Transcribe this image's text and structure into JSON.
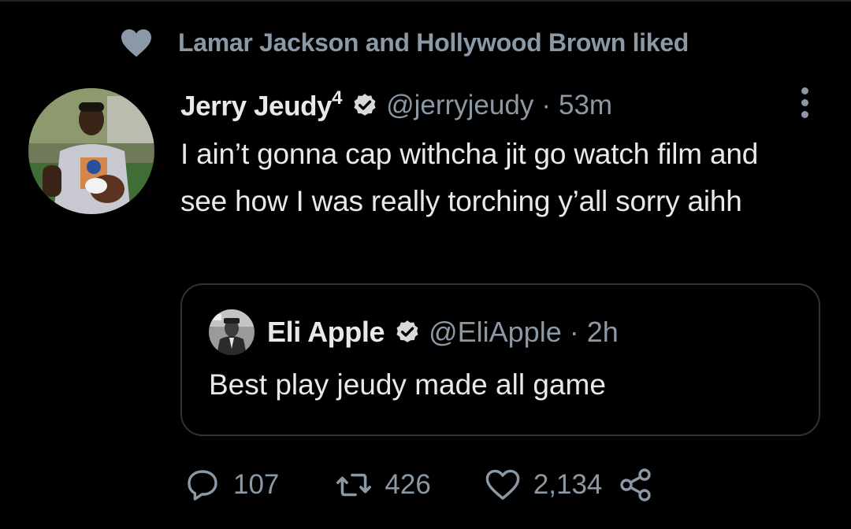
{
  "social_context": {
    "icon": "heart-icon",
    "text": "Lamar Jackson and Hollywood Brown liked"
  },
  "tweet": {
    "author": {
      "display_name": "Jerry Jeudy",
      "superscript": "4",
      "verified_icon": "verified-badge-icon",
      "handle": "@jerryjeudy",
      "separator": "·",
      "time": "53m",
      "avatar_icon": "avatar-photo"
    },
    "text": "I ain’t gonna cap withcha jit go watch film and see how I was really torching y’all sorry aihh",
    "more_icon": "more-options-icon"
  },
  "quote": {
    "author": {
      "display_name": "Eli Apple",
      "verified_icon": "verified-badge-icon",
      "handle": "@EliApple",
      "separator": "·",
      "time": "2h",
      "avatar_icon": "avatar-photo"
    },
    "text": "Best play jeudy made all game"
  },
  "actions": {
    "reply": {
      "icon": "reply-icon",
      "count": "107"
    },
    "retweet": {
      "icon": "retweet-icon",
      "count": "426"
    },
    "like": {
      "icon": "like-icon",
      "count": "2,134"
    },
    "share": {
      "icon": "share-icon"
    }
  },
  "colors": {
    "background": "#000000",
    "primary_text": "#e7e9ea",
    "secondary_text": "#8b98a5",
    "border": "#2f3336"
  }
}
